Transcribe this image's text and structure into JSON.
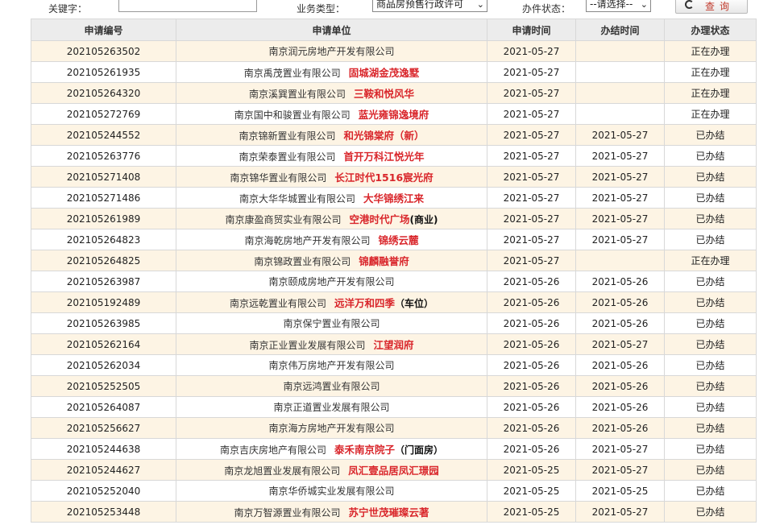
{
  "filters": {
    "keyword_label": "关键字：",
    "keyword_value": "",
    "business_type_label": "业务类型：",
    "business_type_value": "商品房预售行政许可",
    "status_label": "办件状态：",
    "status_value": "--请选择--",
    "query_button": "查询"
  },
  "table": {
    "headers": [
      "申请编号",
      "申请单位",
      "申请时间",
      "办结时间",
      "办理状态"
    ],
    "rows": [
      {
        "id": "202105263502",
        "company": "南京润元房地产开发有限公司",
        "project": "",
        "suffix": "",
        "applied": "2021-05-27",
        "finished": "",
        "status": "正在办理"
      },
      {
        "id": "202105261935",
        "company": "南京禹茂置业有限公司",
        "project": "固城湖金茂逸墅",
        "suffix": "",
        "applied": "2021-05-27",
        "finished": "",
        "status": "正在办理"
      },
      {
        "id": "202105264320",
        "company": "南京溪巽置业有限公司",
        "project": "三鞍和悦风华",
        "suffix": "",
        "applied": "2021-05-27",
        "finished": "",
        "status": "正在办理"
      },
      {
        "id": "202105272769",
        "company": "南京国中和骏置业有限公司",
        "project": "蓝光雍锦逸境府",
        "suffix": "",
        "applied": "2021-05-27",
        "finished": "",
        "status": "正在办理"
      },
      {
        "id": "202105244552",
        "company": "南京锦新置业有限公司",
        "project": "和光锦棠府（新）",
        "suffix": "",
        "applied": "2021-05-27",
        "finished": "2021-05-27",
        "status": "已办结"
      },
      {
        "id": "202105263776",
        "company": "南京荣泰置业有限公司",
        "project": "首开万科江悦光年",
        "suffix": "",
        "applied": "2021-05-27",
        "finished": "2021-05-27",
        "status": "已办结"
      },
      {
        "id": "202105271408",
        "company": "南京锦华置业有限公司",
        "project": "长江时代1516宸光府",
        "suffix": "",
        "applied": "2021-05-27",
        "finished": "2021-05-27",
        "status": "已办结"
      },
      {
        "id": "202105271486",
        "company": "南京大华华城置业有限公司",
        "project": "大华锦绣江来",
        "suffix": "",
        "applied": "2021-05-27",
        "finished": "2021-05-27",
        "status": "已办结"
      },
      {
        "id": "202105261989",
        "company": "南京康盈商贸实业有限公司",
        "project": "空港时代广场",
        "suffix": "(商业)",
        "applied": "2021-05-27",
        "finished": "2021-05-27",
        "status": "已办结"
      },
      {
        "id": "202105264823",
        "company": "南京海乾房地产开发有限公司",
        "project": "锦绣云麓",
        "suffix": "",
        "applied": "2021-05-27",
        "finished": "2021-05-27",
        "status": "已办结"
      },
      {
        "id": "202105264825",
        "company": "南京锦政置业有限公司",
        "project": "锦麟融誉府",
        "suffix": "",
        "applied": "2021-05-27",
        "finished": "",
        "status": "正在办理"
      },
      {
        "id": "202105263987",
        "company": "南京颐成房地产开发有限公司",
        "project": "",
        "suffix": "",
        "applied": "2021-05-26",
        "finished": "2021-05-26",
        "status": "已办结"
      },
      {
        "id": "202105192489",
        "company": "南京远乾置业有限公司",
        "project": "远洋万和四季",
        "suffix": "（车位）",
        "applied": "2021-05-26",
        "finished": "2021-05-26",
        "status": "已办结"
      },
      {
        "id": "202105263985",
        "company": "南京保宁置业有限公司",
        "project": "",
        "suffix": "",
        "applied": "2021-05-26",
        "finished": "2021-05-26",
        "status": "已办结"
      },
      {
        "id": "202105262164",
        "company": "南京正业置业发展有限公司",
        "project": "江望润府",
        "suffix": "",
        "applied": "2021-05-26",
        "finished": "2021-05-27",
        "status": "已办结"
      },
      {
        "id": "202105262034",
        "company": "南京伟万房地产开发有限公司",
        "project": "",
        "suffix": "",
        "applied": "2021-05-26",
        "finished": "2021-05-26",
        "status": "已办结"
      },
      {
        "id": "202105252505",
        "company": "南京远鸿置业有限公司",
        "project": "",
        "suffix": "",
        "applied": "2021-05-26",
        "finished": "2021-05-26",
        "status": "已办结"
      },
      {
        "id": "202105264087",
        "company": "南京正道置业发展有限公司",
        "project": "",
        "suffix": "",
        "applied": "2021-05-26",
        "finished": "2021-05-26",
        "status": "已办结"
      },
      {
        "id": "202105256627",
        "company": "南京海方房地产开发有限公司",
        "project": "",
        "suffix": "",
        "applied": "2021-05-26",
        "finished": "2021-05-26",
        "status": "已办结"
      },
      {
        "id": "202105244638",
        "company": "南京吉庆房地产有限公司",
        "project": "泰禾南京院子",
        "suffix": "（门面房）",
        "applied": "2021-05-26",
        "finished": "2021-05-27",
        "status": "已办结"
      },
      {
        "id": "202105244627",
        "company": "南京龙旭置业发展有限公司",
        "project": "凤汇壹品居凤汇璟园",
        "suffix": "",
        "applied": "2021-05-25",
        "finished": "2021-05-27",
        "status": "已办结"
      },
      {
        "id": "202105252040",
        "company": "南京华侨城实业发展有限公司",
        "project": "",
        "suffix": "",
        "applied": "2021-05-25",
        "finished": "2021-05-25",
        "status": "已办结"
      },
      {
        "id": "202105253448",
        "company": "南京万智源置业有限公司",
        "project": "苏宁世茂璀璨云著",
        "suffix": "",
        "applied": "2021-05-25",
        "finished": "2021-05-27",
        "status": "已办结"
      }
    ]
  }
}
